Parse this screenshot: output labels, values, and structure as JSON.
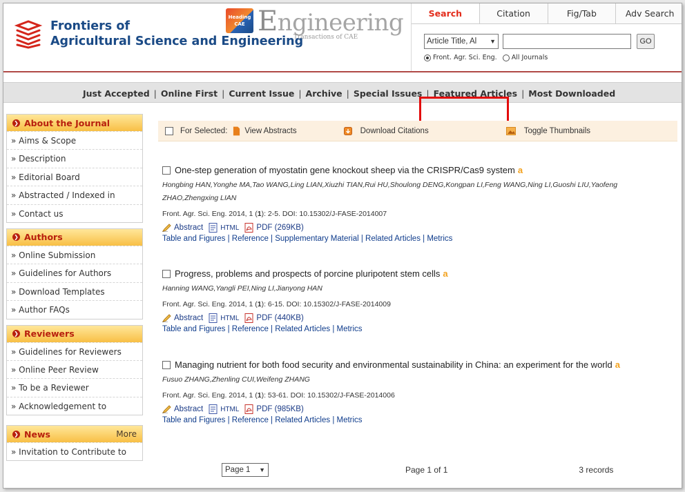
{
  "journal": {
    "line1": "Frontiers of",
    "line2": "Agricultural Science and Engineering"
  },
  "engineering_logo": {
    "cae_top": "Heading",
    "cae_bottom": "CAE",
    "word": "ngineering",
    "word_cap": "E",
    "subtitle": "Transactions of CAE"
  },
  "search": {
    "tabs": [
      "Search",
      "Citation",
      "Fig/Tab",
      "Adv Search"
    ],
    "field_value": "Article Title, Al",
    "go_label": "GO",
    "radio_journal": "Front. Agr. Sci. Eng.",
    "radio_all": "All Journals"
  },
  "nav": {
    "items": [
      "Just Accepted",
      "Online First",
      "Current Issue",
      "Archive",
      "Special Issues",
      "Featured Articles",
      "Most Downloaded"
    ],
    "sep": "|"
  },
  "sidebar": {
    "about": {
      "title": "About the Journal",
      "items": [
        "» Aims & Scope",
        "» Description",
        "» Editorial Board",
        "» Abstracted / Indexed in",
        "» Contact us"
      ]
    },
    "authors": {
      "title": "Authors",
      "items": [
        "» Online Submission",
        "» Guidelines for Authors",
        "» Download Templates",
        "» Author FAQs"
      ]
    },
    "reviewers": {
      "title": "Reviewers",
      "items": [
        "» Guidelines for Reviewers",
        "» Online Peer Review",
        "» To be a Reviewer",
        "» Acknowledgement to"
      ]
    },
    "news": {
      "title": "News",
      "more": "More",
      "items": [
        "» Invitation to Contribute to"
      ]
    }
  },
  "toolbar": {
    "for_selected": "For Selected:",
    "view_abstracts": "View Abstracts",
    "download_citations": "Download Citations",
    "toggle_thumbnails": "Toggle Thumbnails"
  },
  "articles": [
    {
      "title": "One-step generation of myostatin gene knockout sheep via the CRISPR/Cas9 system",
      "authors": "Hongbing HAN,Yonghe MA,Tao WANG,Ling LIAN,Xiuzhi TIAN,Rui HU,Shoulong DENG,Kongpan LI,Feng WANG,Ning LI,Guoshi LIU,Yaofeng ZHAO,Zhengxing LIAN",
      "meta_prefix": "Front. Agr. Sci. Eng.   2014, 1 (",
      "issue": "1",
      "meta_suffix": "): 2-5.   DOI: 10.15302/J-FASE-2014007",
      "pdf": "PDF (269KB)",
      "related": "Table and Figures | Reference | Supplementary Material | Related Articles | Metrics"
    },
    {
      "title": "Progress, problems and prospects of porcine pluripotent stem cells",
      "authors": "Hanning WANG,Yangli PEI,Ning LI,Jianyong HAN",
      "meta_prefix": "Front. Agr. Sci. Eng.   2014, 1 (",
      "issue": "1",
      "meta_suffix": "): 6-15.   DOI: 10.15302/J-FASE-2014009",
      "pdf": "PDF (440KB)",
      "related": "Table and Figures | Reference | Related Articles | Metrics"
    },
    {
      "title": "Managing nutrient for both food security and environmental sustainability in China: an experiment for the world",
      "authors": "Fusuo ZHANG,Zhenling CUI,Weifeng ZHANG",
      "meta_prefix": "Front. Agr. Sci. Eng.   2014, 1 (",
      "issue": "1",
      "meta_suffix": "): 53-61.   DOI: 10.15302/J-FASE-2014006",
      "pdf": "PDF (985KB)",
      "related": "Table and Figures | Reference | Related Articles | Metrics"
    }
  ],
  "links": {
    "abstract": "Abstract",
    "html": "HTML"
  },
  "oa_mark": "a",
  "pager": {
    "page_select": "Page 1",
    "page_of": "Page 1 of 1",
    "records": "3 records"
  },
  "colors": {
    "brand_blue": "#1a4a86",
    "accent_red": "#e32c1b",
    "highlight": "#e30b0b",
    "sidebar_header": "#f8bf45"
  }
}
